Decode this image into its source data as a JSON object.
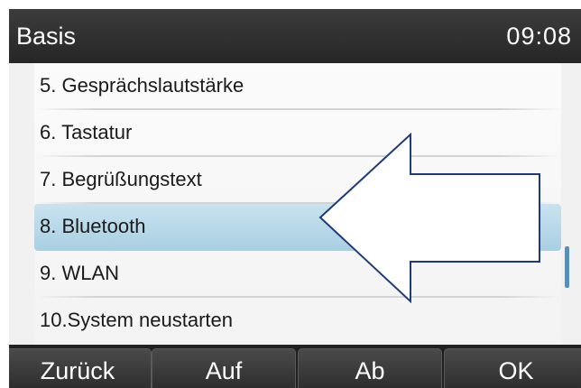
{
  "header": {
    "title": "Basis",
    "time": "09:08"
  },
  "menu": {
    "items": [
      {
        "label": "5. Gesprächslautstärke"
      },
      {
        "label": "6. Tastatur"
      },
      {
        "label": "7. Begrüßungstext"
      },
      {
        "label": "8. Bluetooth",
        "selected": true
      },
      {
        "label": "9. WLAN"
      },
      {
        "label": "10.System neustarten"
      }
    ]
  },
  "softkeys": [
    {
      "label": "Zurück"
    },
    {
      "label": "Auf"
    },
    {
      "label": "Ab"
    },
    {
      "label": "OK"
    }
  ],
  "colors": {
    "selection": "#b5d8ea",
    "titlebar": "#2e2e2e",
    "arrow_outline": "#1f3a7a"
  }
}
